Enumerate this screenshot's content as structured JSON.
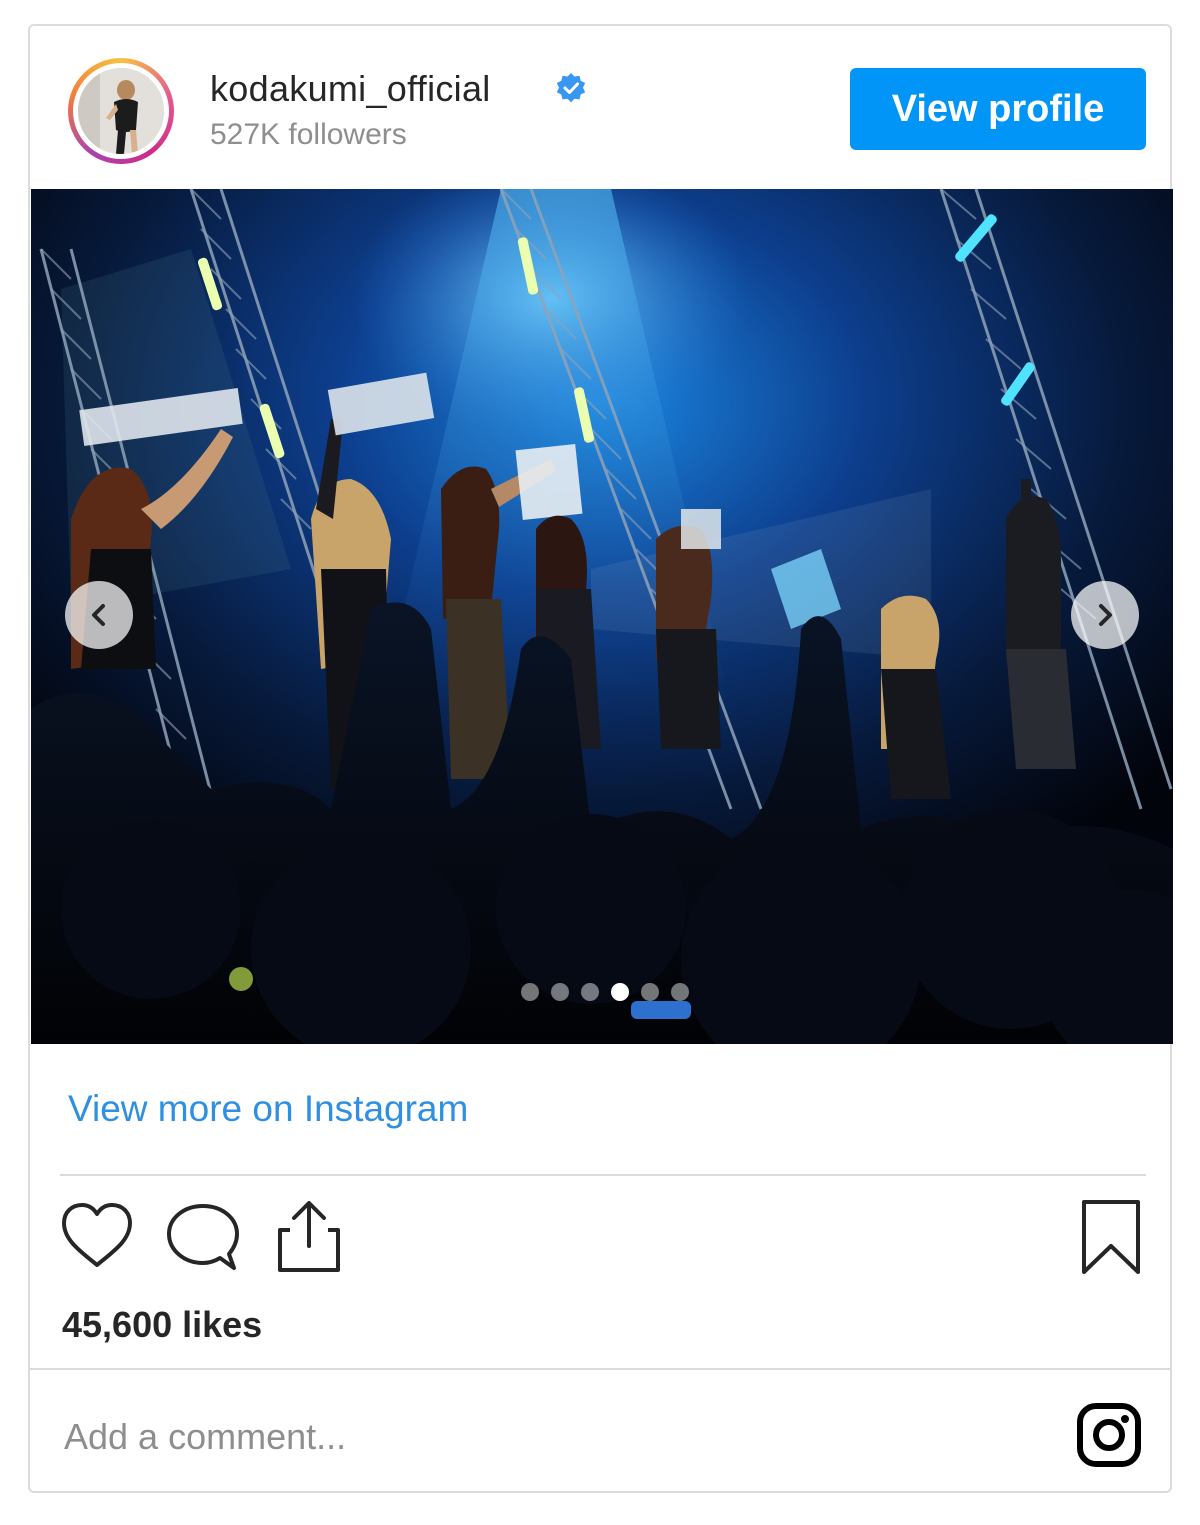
{
  "post": {
    "username": "kodakumi_official",
    "followers": "527K followers",
    "view_profile_label": "View profile",
    "verified": true
  },
  "media": {
    "description_icon": "concert-photo",
    "slide_count": 6,
    "active_slide": 4,
    "prev_icon": "chevron-left-icon",
    "next_icon": "chevron-right-icon"
  },
  "links": {
    "view_more": "View more on Instagram"
  },
  "actions": {
    "like_icon": "heart-icon",
    "comment_icon": "comment-icon",
    "share_icon": "share-icon",
    "save_icon": "bookmark-icon"
  },
  "likes": "45,600 likes",
  "comment": {
    "placeholder": "Add a comment...",
    "value": ""
  },
  "brand": {
    "icon": "instagram-icon",
    "accent": "#0095f6",
    "link_color": "#2f8fe0"
  }
}
